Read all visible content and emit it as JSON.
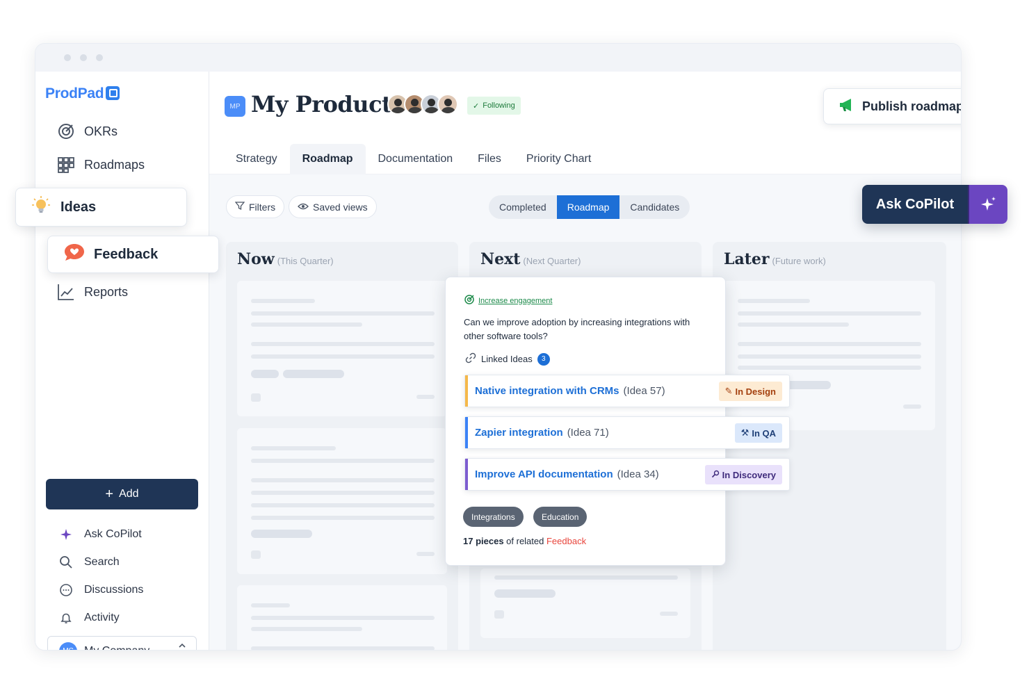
{
  "brand": {
    "name": "ProdPad"
  },
  "sidebar": {
    "items": [
      {
        "label": "OKRs",
        "icon": "okr-target-icon"
      },
      {
        "label": "Roadmaps",
        "icon": "roadmap-grid-icon"
      },
      {
        "label": "Ideas",
        "icon": "lightbulb-icon"
      },
      {
        "label": "Feedback",
        "icon": "feedback-bubble-icon"
      },
      {
        "label": "Reports",
        "icon": "reports-chart-icon"
      }
    ],
    "add_label": "Add",
    "bottom": [
      {
        "label": "Ask CoPilot",
        "icon": "sparkle-icon"
      },
      {
        "label": "Search",
        "icon": "search-icon"
      },
      {
        "label": "Discussions",
        "icon": "chat-bubble-icon"
      },
      {
        "label": "Activity",
        "icon": "bell-icon"
      }
    ],
    "company": {
      "initials": "MC",
      "name": "My Company"
    }
  },
  "header": {
    "product_initials": "MP",
    "product_title": "My Product",
    "following_label": "Following",
    "publish_label": "Publish roadmap"
  },
  "tabs": [
    "Strategy",
    "Roadmap",
    "Documentation",
    "Files",
    "Priority Chart"
  ],
  "active_tab": "Roadmap",
  "toolbar": {
    "filters_label": "Filters",
    "saved_views_label": "Saved views",
    "segments": [
      "Completed",
      "Roadmap",
      "Candidates"
    ],
    "active_segment": "Roadmap"
  },
  "copilot": {
    "label": "Ask CoPilot"
  },
  "columns": [
    {
      "title": "Now",
      "subtitle": "(This Quarter)"
    },
    {
      "title": "Next",
      "subtitle": "(Next Quarter)"
    },
    {
      "title": "Later",
      "subtitle": "(Future work)"
    }
  ],
  "card": {
    "okr": "Increase engagement",
    "question": "Can we improve adoption by increasing integrations with other software tools?",
    "linked_label": "Linked Ideas",
    "linked_count": "3",
    "ideas": [
      {
        "name": "Native integration with CRMs",
        "num": "(Idea 57)",
        "status": "In Design",
        "accent": "#f5b84a",
        "status_bg": "#fdebd3",
        "status_color": "#a4400f"
      },
      {
        "name": "Zapier integration",
        "num": "(Idea 71)",
        "status": "In QA",
        "accent": "#3b82f6",
        "status_bg": "#dbe8fb",
        "status_color": "#1e3f77"
      },
      {
        "name": "Improve API documentation",
        "num": "(Idea 34)",
        "status": "In Discovery",
        "accent": "#7c5ccf",
        "status_bg": "#e9e1fb",
        "status_color": "#3f2b7c"
      }
    ],
    "tags": [
      "Integrations",
      "Education"
    ],
    "related_count": "17 pieces",
    "related_mid": " of related ",
    "related_link": "Feedback"
  },
  "colors": {
    "accent": "#1d6fd6",
    "navy": "#1f3556",
    "copilot_purple": "#6b46c1"
  }
}
